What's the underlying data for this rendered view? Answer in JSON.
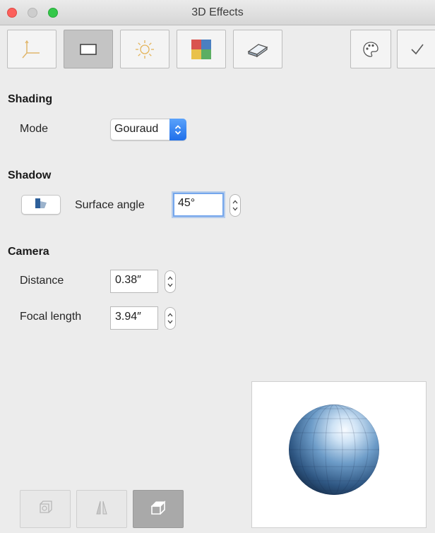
{
  "window": {
    "title": "3D Effects"
  },
  "toolbar": {
    "buttons": [
      {
        "name": "geometry",
        "icon": "axes-icon",
        "active": false
      },
      {
        "name": "shading",
        "icon": "rectangle-icon",
        "active": true
      },
      {
        "name": "illumination",
        "icon": "sun-icon",
        "active": false
      },
      {
        "name": "textures",
        "icon": "color-grid-icon",
        "active": false
      },
      {
        "name": "material",
        "icon": "eraser-icon",
        "active": false
      },
      {
        "name": "favorites",
        "icon": "palette-icon",
        "active": false
      },
      {
        "name": "assign",
        "icon": "checkmark-icon",
        "active": false
      }
    ]
  },
  "shading": {
    "heading": "Shading",
    "mode_label": "Mode",
    "mode_value": "Gouraud"
  },
  "shadow": {
    "heading": "Shadow",
    "surface_angle_label": "Surface angle",
    "surface_angle_value": "45°"
  },
  "camera": {
    "heading": "Camera",
    "distance_label": "Distance",
    "distance_value": "0.38″",
    "focal_length_label": "Focal length",
    "focal_length_value": "3.94″"
  },
  "bottom_buttons": [
    {
      "name": "convert-to-3d",
      "icon": "convert-3d-icon",
      "active": false
    },
    {
      "name": "perspective",
      "icon": "perspective-icon",
      "active": false
    },
    {
      "name": "view-3d",
      "icon": "cube-icon",
      "active": true
    }
  ],
  "colors": {
    "accent_blue": "#1f6fea",
    "sphere_dark": "#1d3a5c",
    "sphere_light": "#e6f3ff"
  }
}
